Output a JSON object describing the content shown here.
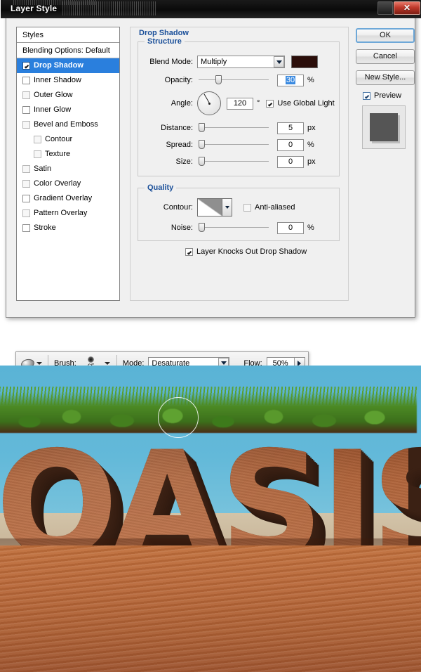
{
  "dialog": {
    "title": "Layer Style",
    "watermark": "",
    "close_label": "✕",
    "styles_header": "Styles",
    "blending_options": "Blending Options: Default",
    "effects": [
      {
        "label": "Drop Shadow",
        "checked": true,
        "selected": true,
        "indent": false,
        "dim": false
      },
      {
        "label": "Inner Shadow",
        "checked": false,
        "selected": false,
        "indent": false,
        "dim": false
      },
      {
        "label": "Outer Glow",
        "checked": false,
        "selected": false,
        "indent": false,
        "dim": true
      },
      {
        "label": "Inner Glow",
        "checked": false,
        "selected": false,
        "indent": false,
        "dim": false
      },
      {
        "label": "Bevel and Emboss",
        "checked": false,
        "selected": false,
        "indent": false,
        "dim": true
      },
      {
        "label": "Contour",
        "checked": false,
        "selected": false,
        "indent": true,
        "dim": true
      },
      {
        "label": "Texture",
        "checked": false,
        "selected": false,
        "indent": true,
        "dim": true
      },
      {
        "label": "Satin",
        "checked": false,
        "selected": false,
        "indent": false,
        "dim": true
      },
      {
        "label": "Color Overlay",
        "checked": false,
        "selected": false,
        "indent": false,
        "dim": true
      },
      {
        "label": "Gradient Overlay",
        "checked": false,
        "selected": false,
        "indent": false,
        "dim": false
      },
      {
        "label": "Pattern Overlay",
        "checked": false,
        "selected": false,
        "indent": false,
        "dim": true
      },
      {
        "label": "Stroke",
        "checked": false,
        "selected": false,
        "indent": false,
        "dim": false
      }
    ],
    "panel": {
      "section_title": "Drop Shadow",
      "structure": {
        "legend": "Structure",
        "blend_mode_label": "Blend Mode:",
        "blend_mode_value": "Multiply",
        "shadow_color": "#2b0e0a",
        "opacity_label": "Opacity:",
        "opacity_value": "30",
        "opacity_unit": "%",
        "angle_label": "Angle:",
        "angle_value": "120",
        "angle_unit": "°",
        "use_global_light": "Use Global Light",
        "use_global_light_checked": true,
        "distance_label": "Distance:",
        "distance_value": "5",
        "distance_unit": "px",
        "spread_label": "Spread:",
        "spread_value": "0",
        "spread_unit": "%",
        "size_label": "Size:",
        "size_value": "0",
        "size_unit": "px"
      },
      "quality": {
        "legend": "Quality",
        "contour_label": "Contour:",
        "anti_aliased": "Anti-aliased",
        "anti_aliased_checked": false,
        "noise_label": "Noise:",
        "noise_value": "0",
        "noise_unit": "%",
        "knockout_label": "Layer Knocks Out Drop Shadow",
        "knockout_checked": true
      }
    },
    "buttons": {
      "ok": "OK",
      "cancel": "Cancel",
      "new_style": "New Style...",
      "preview": "Preview",
      "preview_checked": true
    }
  },
  "options_bar": {
    "brush_label": "Brush:",
    "brush_size": "65",
    "mode_label": "Mode:",
    "mode_value": "Desaturate",
    "flow_label": "Flow:",
    "flow_value": "50%"
  },
  "artwork": {
    "word": "OASIS",
    "sky_color": "#5ab3d6",
    "grass_color": "#4c8a24",
    "soil_color": "#b2643b",
    "sand_color": "#b9693a"
  }
}
